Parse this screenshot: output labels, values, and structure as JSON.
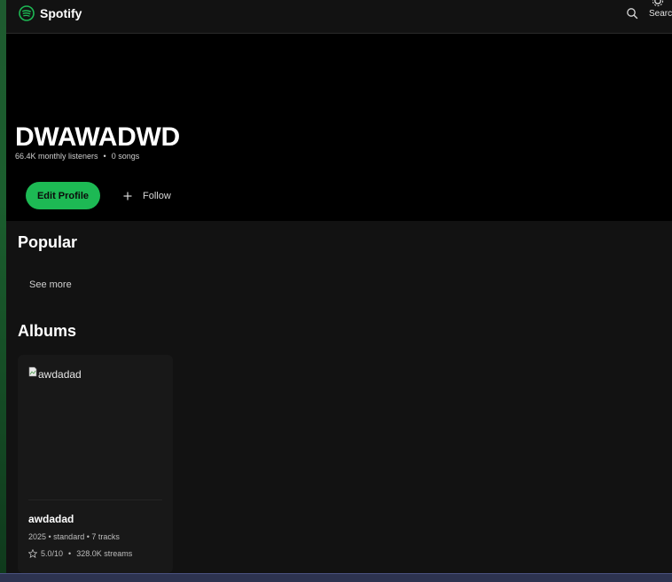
{
  "app": {
    "name": "Spotify"
  },
  "header": {
    "search_label": "Search"
  },
  "artist": {
    "name": "DWAWADWD",
    "monthly_listeners": "66.4K monthly listeners",
    "songs": "0 songs",
    "edit_label": "Edit Profile",
    "follow_label": "Follow"
  },
  "popular": {
    "title": "Popular",
    "see_more": "See more"
  },
  "albums": {
    "title": "Albums",
    "items": [
      {
        "image_alt": "awdadad",
        "title": "awdadad",
        "info": "2025 • standard • 7 tracks",
        "rating": "5.0/10",
        "streams": "328.0K streams"
      }
    ]
  },
  "colors": {
    "accent": "#1db954",
    "background": "#121212",
    "hero": "#000000"
  },
  "icons": [
    "spotify-logo-icon",
    "search-icon",
    "gear-icon",
    "plus-icon",
    "broken-image-icon",
    "star-icon"
  ]
}
